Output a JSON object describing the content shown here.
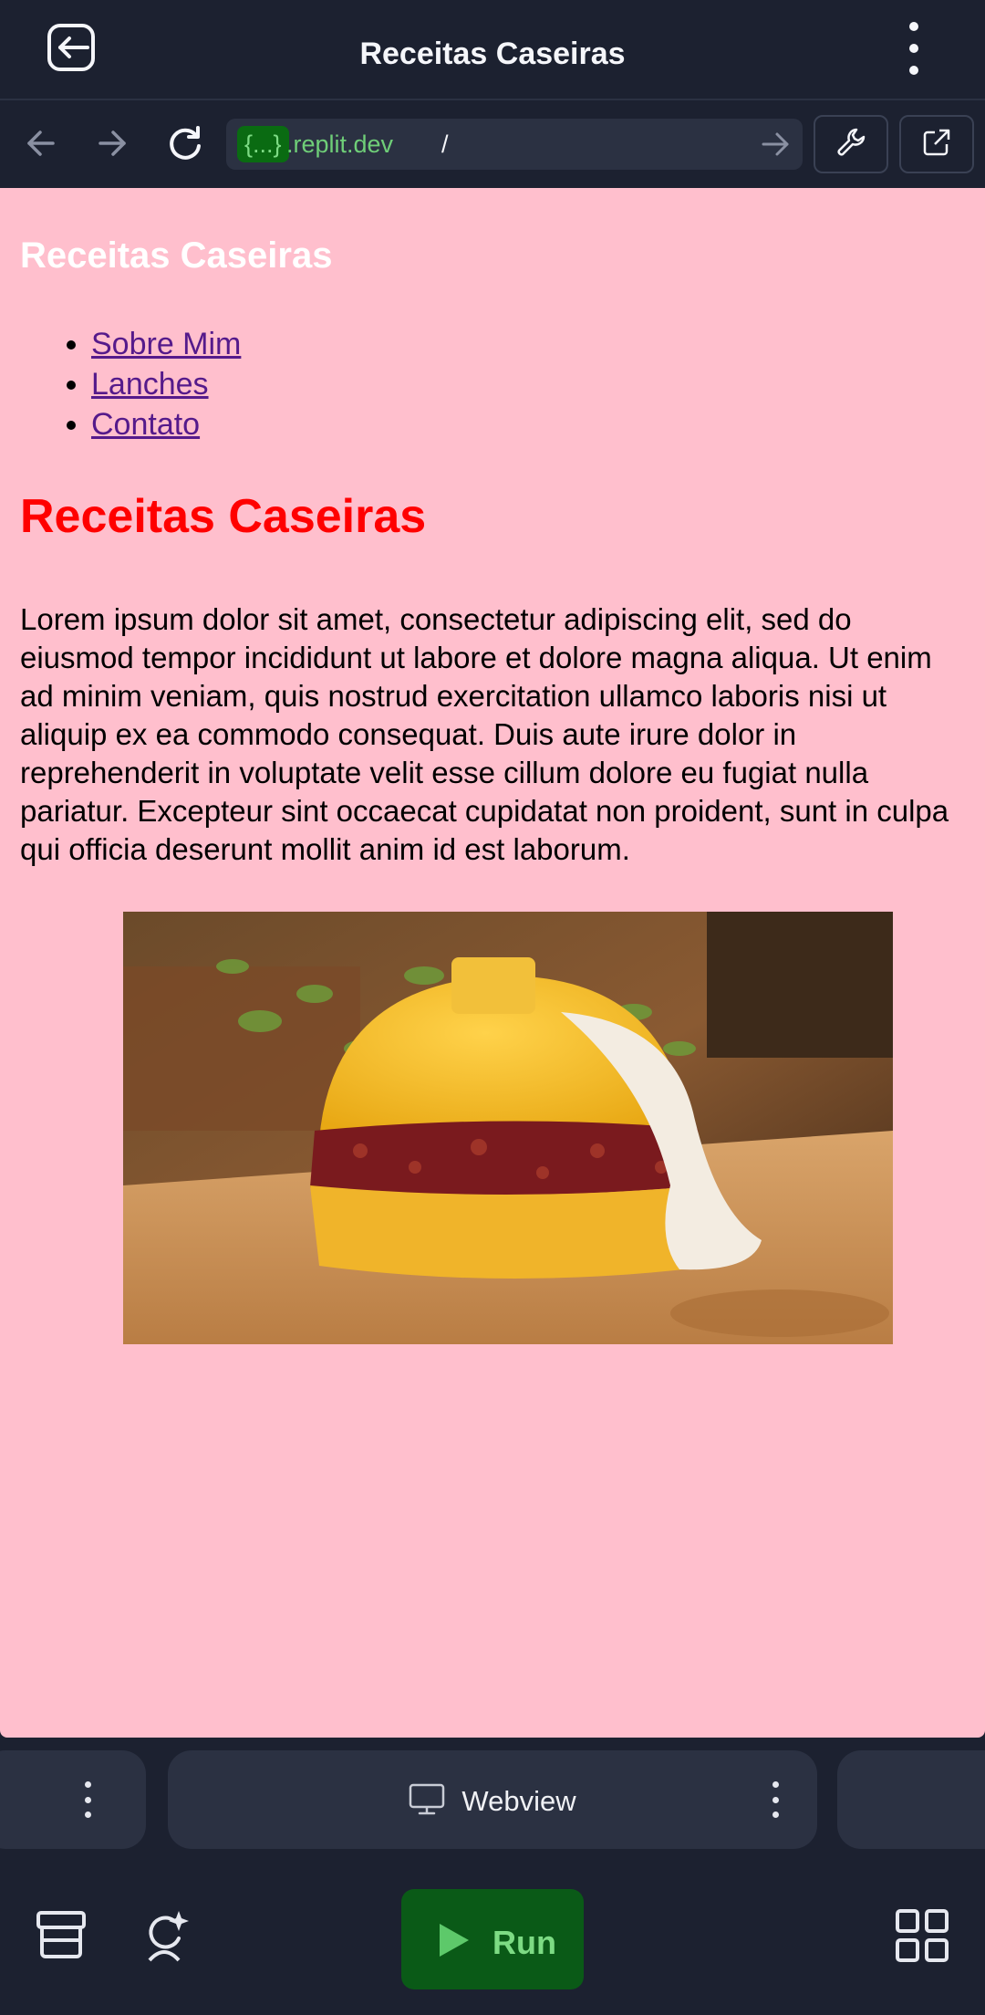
{
  "app": {
    "title": "Receitas Caseiras",
    "back_icon": "exit-icon",
    "menu_icon": "kebab-menu-icon"
  },
  "browser": {
    "url_badge": "{...}",
    "url_domain": ".replit.dev",
    "url_path": "/",
    "icons": [
      "back-arrow-icon",
      "forward-arrow-icon",
      "reload-icon",
      "go-arrow-icon",
      "wrench-icon",
      "external-link-icon"
    ]
  },
  "site": {
    "name": "Receitas Caseiras",
    "nav": [
      "Sobre Mim",
      "Lanches",
      "Contato"
    ],
    "heading": "Receitas Caseiras",
    "paragraph": "Lorem ipsum dolor sit amet, consectetur adipiscing elit, sed do eiusmod tempor incididunt ut labore et dolore magna aliqua. Ut enim ad minim veniam, quis nostrud exercitation ullamco laboris nisi ut aliquip ex ea commodo consequat. Duis aute irure dolor in reprehenderit in voluptate velit esse cillum dolore eu fugiat nulla pariatur. Excepteur sint occaecat cupidatat non proident, sunt in culpa qui officia deserunt mollit anim id est laborum.",
    "background": "#ffbfcd",
    "heading_color": "#ff0000",
    "link_color": "#551a8b"
  },
  "panes": {
    "active_tab": "Webview"
  },
  "toolbar": {
    "run_label": "Run",
    "run_color": "#0a5a17"
  }
}
